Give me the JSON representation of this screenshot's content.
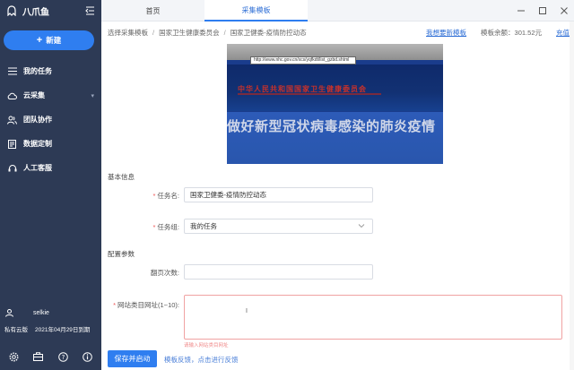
{
  "app": {
    "name": "八爪鱼"
  },
  "sidebar": {
    "new_label": "新建",
    "items": [
      {
        "label": "我的任务",
        "icon": "list-icon"
      },
      {
        "label": "云采集",
        "icon": "cloud-icon",
        "expandable": true
      },
      {
        "label": "团队协作",
        "icon": "team-icon"
      },
      {
        "label": "数据定制",
        "icon": "data-icon"
      },
      {
        "label": "人工客服",
        "icon": "headset-icon"
      }
    ],
    "user": {
      "name": "selkie"
    },
    "plan": {
      "label": "私有云版",
      "expiry": "2021年04月29日到期"
    }
  },
  "tabs": [
    {
      "label": "首页"
    },
    {
      "label": "采集模板"
    }
  ],
  "breadcrumb": {
    "items": [
      "选择采集模板",
      "国家卫生健康委员会",
      "国家卫健委-疫情防控动态"
    ],
    "want_template": "我想要新模板",
    "balance": "模板余额：301.52元",
    "recharge": "充值"
  },
  "preview": {
    "url": "http://www.nhc.gov.cn/xcs/yqfkdt/list_gzbd.shtml",
    "org_title": "中华人民共和国国家卫生健康委员会",
    "headline": "做好新型冠状病毒感染的肺炎疫情"
  },
  "form": {
    "basic_title": "基本信息",
    "task_name_label": "任务名:",
    "task_name_value": "国家卫健委-疫情防控动态",
    "task_group_label": "任务组:",
    "task_group_value": "我的任务",
    "config_title": "配置参数",
    "pages_label": "翻页次数:",
    "pages_value": "",
    "url_label": "网站类目网址(1~10):",
    "url_value": "",
    "error_text": "请输入网站类目网址"
  },
  "actions": {
    "save_label": "保存并启动",
    "feedback_label": "模板反馈，点击进行反馈"
  },
  "colors": {
    "sidebar_bg": "#2d3a55",
    "accent": "#2f7ef0",
    "error": "#f0a2a2"
  }
}
